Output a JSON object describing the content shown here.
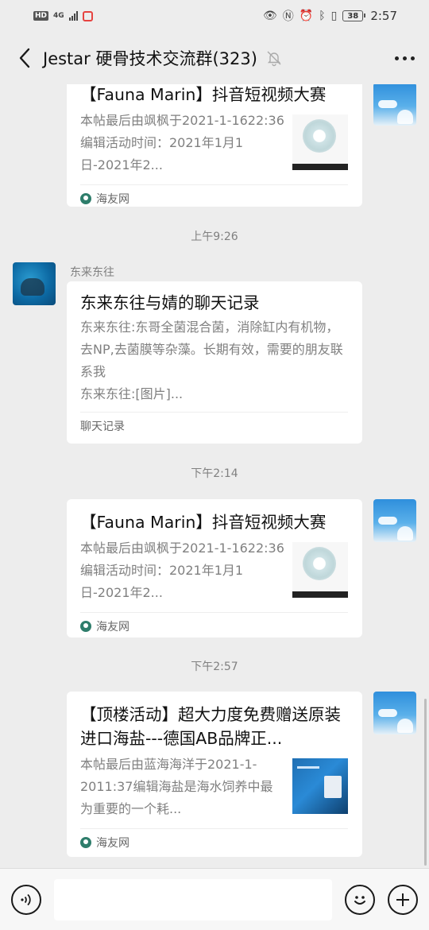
{
  "status_bar": {
    "hd": "HD",
    "network": "4G",
    "battery": "38",
    "time": "2:57"
  },
  "header": {
    "title": "Jestar 硬骨技术交流群(323)"
  },
  "messages": {
    "m1": {
      "title": "【Fauna Marin】抖音短视频大赛",
      "desc": "本帖最后由飒枫于2021-1-1622:36编辑活动时间：2021年1月1日-2021年2...",
      "source": "海友网"
    },
    "ts1": "上午9:26",
    "m2": {
      "sender": "东来东往",
      "title": "东来东往与婧的聊天记录",
      "desc": "东来东往:东哥全菌混合菌，消除缸内有机物，去NP,去菌膜等杂藻。长期有效，需要的朋友联系我\n东来东往:[图片]...",
      "footer": "聊天记录"
    },
    "ts2": "下午2:14",
    "m3": {
      "title": "【Fauna Marin】抖音短视频大赛",
      "desc": "本帖最后由飒枫于2021-1-1622:36编辑活动时间：2021年1月1日-2021年2...",
      "source": "海友网"
    },
    "ts3": "下午2:57",
    "m4": {
      "title": "【顶楼活动】超大力度免费赠送原装进口海盐---德国AB品牌正...",
      "desc": "本帖最后由蓝海海洋于2021-1-2011:37编辑海盐是海水饲养中最为重要的一个耗...",
      "source": "海友网"
    }
  },
  "icons": {
    "back": "chevron-left-icon",
    "mute": "bell-off-icon",
    "more": "more-icon",
    "voice": "voice-icon",
    "emoji": "emoji-icon",
    "plus": "plus-icon"
  },
  "colors": {
    "background": "#ededed",
    "card": "#ffffff",
    "muted_text": "#808080",
    "site_icon": "#2e7d6b"
  }
}
